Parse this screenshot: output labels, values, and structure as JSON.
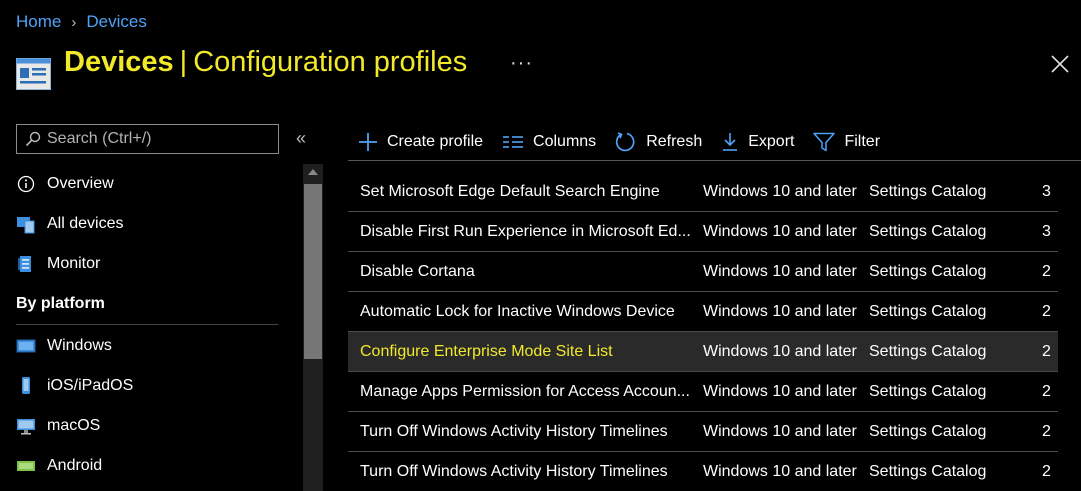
{
  "breadcrumb": {
    "home": "Home",
    "separator": "›",
    "devices": "Devices"
  },
  "header": {
    "title_main": "Devices",
    "title_sep": "|",
    "title_sub": "Configuration profiles",
    "more": "···"
  },
  "search": {
    "placeholder": "Search (Ctrl+/)"
  },
  "sidebar": {
    "collapse": "«",
    "items": [
      {
        "label": "Overview",
        "icon": "info-icon"
      },
      {
        "label": "All devices",
        "icon": "devices-icon"
      },
      {
        "label": "Monitor",
        "icon": "monitor-icon"
      }
    ],
    "section": "By platform",
    "platforms": [
      {
        "label": "Windows",
        "icon": "windows-icon"
      },
      {
        "label": "iOS/iPadOS",
        "icon": "ios-icon"
      },
      {
        "label": "macOS",
        "icon": "macos-icon"
      },
      {
        "label": "Android",
        "icon": "android-icon"
      }
    ]
  },
  "toolbar": {
    "create": "Create profile",
    "columns": "Columns",
    "refresh": "Refresh",
    "export": "Export",
    "filter": "Filter"
  },
  "table": {
    "rows": [
      {
        "name": "Set Microsoft Edge Default Search Engine",
        "platform": "Windows 10 and later",
        "type": "Settings Catalog",
        "extra": "3"
      },
      {
        "name": "Disable First Run Experience in Microsoft Ed...",
        "platform": "Windows 10 and later",
        "type": "Settings Catalog",
        "extra": "3"
      },
      {
        "name": "Disable Cortana",
        "platform": "Windows 10 and later",
        "type": "Settings Catalog",
        "extra": "2"
      },
      {
        "name": "Automatic Lock for Inactive Windows Device",
        "platform": "Windows 10 and later",
        "type": "Settings Catalog",
        "extra": "2"
      },
      {
        "name": "Configure Enterprise Mode Site List",
        "platform": "Windows 10 and later",
        "type": "Settings Catalog",
        "extra": "2"
      },
      {
        "name": "Manage Apps Permission for Access Accoun...",
        "platform": "Windows 10 and later",
        "type": "Settings Catalog",
        "extra": "2"
      },
      {
        "name": "Turn Off Windows Activity History Timelines",
        "platform": "Windows 10 and later",
        "type": "Settings Catalog",
        "extra": "2"
      },
      {
        "name": "Turn Off Windows Activity History Timelines",
        "platform": "Windows 10 and later",
        "type": "Settings Catalog",
        "extra": "2"
      }
    ]
  },
  "colors": {
    "accent": "#4fa3f7",
    "highlight": "#f2e92b",
    "background": "#000000"
  }
}
